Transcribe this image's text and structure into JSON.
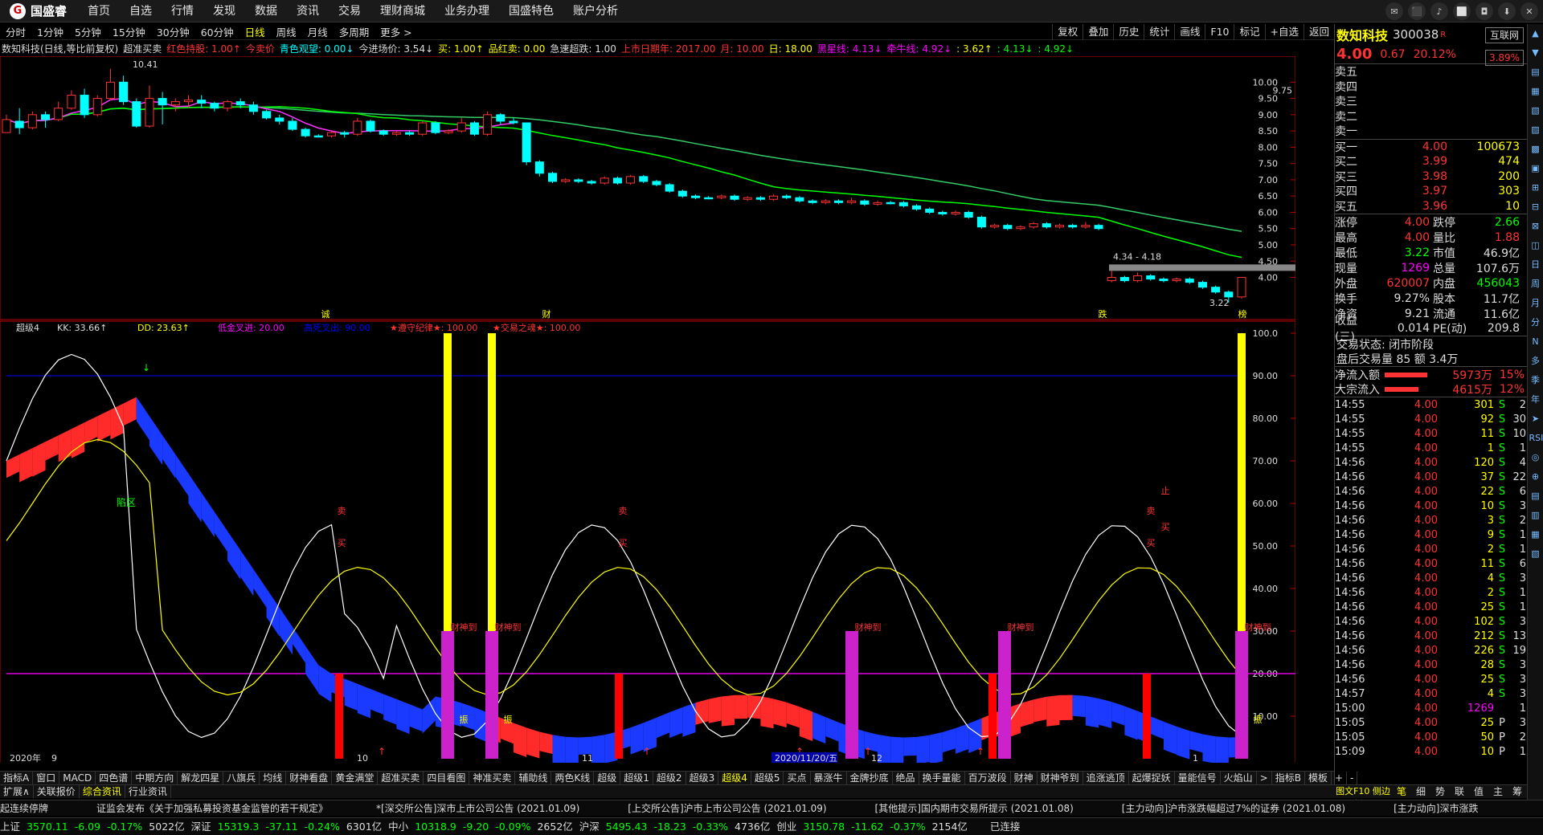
{
  "app": {
    "logo_text": "国盛睿",
    "menu": [
      "首页",
      "自选",
      "行情",
      "发现",
      "数据",
      "资讯",
      "交易",
      "理财商城",
      "业务办理",
      "国盛特色",
      "账户分析"
    ],
    "window_controls": [
      "✉",
      "⬛",
      "♪",
      "⬜",
      "◘",
      "⬇",
      "✕"
    ]
  },
  "periods": {
    "items": [
      "分时",
      "1分钟",
      "5分钟",
      "15分钟",
      "30分钟",
      "60分钟",
      "日线",
      "周线",
      "月线",
      "多周期",
      "更多 >"
    ],
    "active": "日线"
  },
  "right_tools": [
    "复权",
    "叠加",
    "历史",
    "统计",
    "画线",
    "F10",
    "标记",
    "+自选",
    "返回"
  ],
  "chart_info": [
    {
      "text": "数知科技(日线,等比前复权)",
      "color": "white"
    },
    {
      "text": "超准买卖",
      "color": "white"
    },
    {
      "text": "红色持股: 1.00↑",
      "color": "red"
    },
    {
      "text": "今卖价",
      "color": "red"
    },
    {
      "text": "青色观望: 0.00↓",
      "color": "cyan"
    },
    {
      "text": "今进场价: 3.54↓",
      "color": "white"
    },
    {
      "text": "买: 1.00↑",
      "color": "yellow"
    },
    {
      "text": "品红卖: 0.00",
      "color": "yellow"
    },
    {
      "text": "急速超跌: 1.00",
      "color": "white"
    },
    {
      "text": "上市日期年: 2017.00",
      "color": "red"
    },
    {
      "text": "月: 10.00",
      "color": "red"
    },
    {
      "text": "日: 18.00",
      "color": "yellow"
    },
    {
      "text": "黑星线: 4.13↓",
      "color": "magenta"
    },
    {
      "text": "牵牛线: 4.92↓",
      "color": "magenta"
    },
    {
      "text": ": 3.62↑",
      "color": "yellow"
    },
    {
      "text": ": 4.13↓",
      "color": "green"
    },
    {
      "text": ": 4.92↓",
      "color": "green"
    }
  ],
  "chart_data": [
    {
      "type": "candlestick",
      "title": "数知科技(日线,等比前复权)",
      "y_ticks": [
        "10.00",
        "9.50",
        "9.00",
        "8.50",
        "8.00",
        "7.50",
        "7.00",
        "6.50",
        "6.00",
        "5.50",
        "5.00",
        "4.50",
        "4.00"
      ],
      "ylim": [
        3.1,
        10.6
      ],
      "x_ticks": [
        "2020年",
        "9",
        "10",
        "11",
        "2020/11/20/五",
        "12",
        "1"
      ],
      "labels": {
        "high": "10.41",
        "low": "3.22",
        "range": "4.34 - 4.18",
        "price_box": "9.75"
      },
      "markers": [
        "诚",
        "财",
        "跌",
        "榜"
      ],
      "ohlc": [
        [
          8.45,
          8.85,
          8.75,
          9.0,
          1
        ],
        [
          8.8,
          8.6,
          9.2,
          8.4,
          0
        ],
        [
          8.6,
          9.0,
          8.55,
          9.1,
          1
        ],
        [
          9.0,
          8.85,
          9.1,
          8.6,
          0
        ],
        [
          8.85,
          9.2,
          8.8,
          9.4,
          1
        ],
        [
          9.2,
          9.6,
          9.15,
          9.75,
          1
        ],
        [
          9.6,
          9.0,
          9.8,
          8.9,
          0
        ],
        [
          9.0,
          9.5,
          8.95,
          9.6,
          1
        ],
        [
          9.5,
          10.0,
          9.45,
          10.41,
          1
        ],
        [
          10.0,
          9.4,
          10.2,
          9.3,
          0
        ],
        [
          9.4,
          8.65,
          9.5,
          8.6,
          0
        ],
        [
          8.65,
          9.5,
          8.6,
          9.9,
          1
        ],
        [
          9.5,
          9.3,
          9.7,
          8.7,
          0
        ],
        [
          9.3,
          9.4,
          9.1,
          9.5,
          1
        ],
        [
          9.4,
          9.45,
          9.2,
          9.6,
          1
        ],
        [
          9.45,
          9.35,
          9.6,
          9.2,
          0
        ],
        [
          9.35,
          9.2,
          9.4,
          9.1,
          0
        ],
        [
          9.2,
          9.4,
          9.1,
          9.45,
          1
        ],
        [
          9.4,
          9.3,
          9.5,
          9.2,
          0
        ],
        [
          9.3,
          9.1,
          9.4,
          9.0,
          0
        ],
        [
          9.1,
          8.9,
          9.15,
          8.85,
          0
        ],
        [
          8.9,
          8.8,
          9.0,
          8.7,
          0
        ],
        [
          8.8,
          8.55,
          8.9,
          8.5,
          0
        ],
        [
          8.55,
          8.35,
          8.6,
          8.3,
          0
        ],
        [
          8.35,
          8.35,
          8.4,
          8.3,
          0
        ],
        [
          8.35,
          8.45,
          8.3,
          8.5,
          1
        ],
        [
          8.45,
          8.4,
          8.5,
          8.3,
          0
        ],
        [
          8.4,
          8.8,
          8.35,
          8.9,
          1
        ],
        [
          8.8,
          8.5,
          8.85,
          8.45,
          0
        ],
        [
          8.5,
          8.4,
          8.55,
          8.35,
          0
        ],
        [
          8.4,
          8.45,
          8.35,
          8.5,
          1
        ],
        [
          8.45,
          8.4,
          8.5,
          8.35,
          0
        ],
        [
          8.4,
          8.75,
          8.35,
          8.8,
          1
        ],
        [
          8.75,
          8.45,
          8.8,
          8.4,
          0
        ],
        [
          8.45,
          8.5,
          8.4,
          8.55,
          1
        ],
        [
          8.5,
          8.75,
          8.45,
          8.9,
          1
        ],
        [
          8.75,
          8.4,
          8.8,
          8.35,
          0
        ],
        [
          8.4,
          9.0,
          8.35,
          9.1,
          1
        ],
        [
          9.0,
          8.8,
          9.05,
          8.7,
          0
        ],
        [
          8.8,
          8.75,
          8.9,
          8.7,
          0
        ],
        [
          8.75,
          7.55,
          8.75,
          7.45,
          0
        ],
        [
          7.55,
          7.2,
          7.6,
          7.1,
          0
        ],
        [
          7.2,
          6.95,
          7.25,
          6.9,
          0
        ],
        [
          6.95,
          7.0,
          6.9,
          7.05,
          1
        ],
        [
          7.0,
          6.95,
          7.05,
          6.9,
          0
        ],
        [
          6.95,
          6.9,
          7.0,
          6.85,
          0
        ],
        [
          6.9,
          7.05,
          6.85,
          7.1,
          1
        ],
        [
          7.05,
          6.9,
          7.1,
          6.85,
          0
        ],
        [
          6.9,
          7.1,
          6.85,
          7.15,
          1
        ],
        [
          7.1,
          6.95,
          7.15,
          6.9,
          0
        ],
        [
          6.95,
          6.85,
          7.0,
          6.8,
          0
        ],
        [
          6.85,
          6.65,
          6.9,
          6.6,
          0
        ],
        [
          6.65,
          6.5,
          6.7,
          6.45,
          0
        ],
        [
          6.5,
          6.45,
          6.55,
          6.4,
          0
        ],
        [
          6.45,
          6.45,
          6.5,
          6.4,
          0
        ],
        [
          6.45,
          6.5,
          6.4,
          6.55,
          1
        ],
        [
          6.5,
          6.4,
          6.55,
          6.35,
          0
        ],
        [
          6.4,
          6.45,
          6.35,
          6.5,
          1
        ],
        [
          6.45,
          6.4,
          6.5,
          6.35,
          0
        ],
        [
          6.4,
          6.5,
          6.35,
          6.55,
          1
        ],
        [
          6.5,
          6.45,
          6.55,
          6.4,
          0
        ],
        [
          6.45,
          6.35,
          6.5,
          6.3,
          0
        ],
        [
          6.35,
          6.3,
          6.4,
          6.25,
          0
        ],
        [
          6.3,
          6.35,
          6.25,
          6.4,
          1
        ],
        [
          6.35,
          6.3,
          6.4,
          6.25,
          0
        ],
        [
          6.3,
          6.35,
          6.25,
          6.45,
          1
        ],
        [
          6.35,
          6.25,
          6.4,
          6.2,
          0
        ],
        [
          6.25,
          6.3,
          6.2,
          6.35,
          1
        ],
        [
          6.3,
          6.3,
          6.35,
          6.25,
          0
        ],
        [
          6.3,
          6.2,
          6.35,
          6.15,
          0
        ],
        [
          6.2,
          6.1,
          6.25,
          6.05,
          0
        ],
        [
          6.1,
          6.0,
          6.15,
          5.95,
          0
        ],
        [
          6.0,
          5.95,
          6.05,
          5.9,
          0
        ],
        [
          5.95,
          6.0,
          5.9,
          6.05,
          1
        ],
        [
          6.0,
          5.85,
          6.05,
          5.8,
          0
        ],
        [
          5.85,
          5.55,
          5.9,
          5.5,
          0
        ],
        [
          5.55,
          5.6,
          5.5,
          5.65,
          1
        ],
        [
          5.6,
          5.5,
          5.65,
          5.45,
          0
        ],
        [
          5.5,
          5.55,
          5.45,
          5.6,
          1
        ],
        [
          5.55,
          5.65,
          5.5,
          5.7,
          1
        ],
        [
          5.65,
          5.55,
          5.7,
          5.5,
          0
        ],
        [
          5.55,
          5.6,
          5.5,
          5.65,
          1
        ],
        [
          5.6,
          5.55,
          5.65,
          5.5,
          0
        ],
        [
          5.55,
          5.6,
          5.5,
          5.7,
          1
        ],
        [
          5.6,
          5.5,
          5.65,
          5.45,
          0
        ],
        [
          3.9,
          4.0,
          3.85,
          4.2,
          1
        ],
        [
          4.0,
          3.9,
          4.05,
          3.85,
          0
        ],
        [
          3.9,
          4.05,
          3.85,
          4.15,
          1
        ],
        [
          4.05,
          3.95,
          4.1,
          3.9,
          0
        ],
        [
          3.95,
          3.9,
          4.0,
          3.85,
          0
        ],
        [
          3.9,
          3.95,
          3.85,
          4.0,
          1
        ],
        [
          3.95,
          3.85,
          4.0,
          3.8,
          0
        ],
        [
          3.85,
          3.7,
          3.9,
          3.65,
          0
        ],
        [
          3.7,
          3.55,
          3.75,
          3.5,
          0
        ],
        [
          3.55,
          3.4,
          3.6,
          3.22,
          0
        ],
        [
          3.4,
          4.0,
          3.35,
          4.0,
          1
        ]
      ]
    },
    {
      "type": "line",
      "title": "超级4",
      "legend": [
        "KK: 33.66↑",
        "DD: 23.63↑",
        "低金叉进: 20.00",
        "高死叉出: 90.00",
        "★遵守纪律★: 100.00",
        "★交易之魂★: 100.00"
      ],
      "y_ticks": [
        "100.0",
        "90.00",
        "80.00",
        "70.00",
        "60.00",
        "50.00",
        "40.00",
        "30.00",
        "20.00",
        "10.00"
      ],
      "ylim": [
        0,
        100
      ],
      "lines": {
        "low": 20,
        "high": 90
      },
      "annotations": [
        "陷区",
        "卖",
        "买",
        "财神到",
        "振",
        "止"
      ]
    }
  ],
  "right_panel": {
    "name": "数知科技",
    "code": "300038",
    "code_flag": "R",
    "btn_top": "互联网",
    "price": "4.00",
    "change": "0.67",
    "change_pct": "20.12%",
    "price_box": "3.89%",
    "sells": [
      {
        "label": "卖五",
        "price": "",
        "vol": ""
      },
      {
        "label": "卖四",
        "price": "",
        "vol": ""
      },
      {
        "label": "卖三",
        "price": "",
        "vol": ""
      },
      {
        "label": "卖二",
        "price": "",
        "vol": ""
      },
      {
        "label": "卖一",
        "price": "",
        "vol": ""
      }
    ],
    "buys": [
      {
        "label": "买一",
        "price": "4.00",
        "vol": "100673"
      },
      {
        "label": "买二",
        "price": "3.99",
        "vol": "474"
      },
      {
        "label": "买三",
        "price": "3.98",
        "vol": "200"
      },
      {
        "label": "买四",
        "price": "3.97",
        "vol": "303"
      },
      {
        "label": "买五",
        "price": "3.96",
        "vol": "10"
      }
    ],
    "stats": [
      {
        "k1": "涨停",
        "v1": "4.00",
        "c1": "red",
        "k2": "跌停",
        "v2": "2.66",
        "c2": "green"
      },
      {
        "k1": "最高",
        "v1": "4.00",
        "c1": "red",
        "k2": "量比",
        "v2": "1.88",
        "c2": "red"
      },
      {
        "k1": "最低",
        "v1": "3.22",
        "c1": "green",
        "k2": "市值",
        "v2": "46.9亿",
        "c2": "white"
      },
      {
        "k1": "现量",
        "v1": "1269",
        "c1": "magenta",
        "k2": "总量",
        "v2": "107.6万",
        "c2": "white"
      },
      {
        "k1": "外盘",
        "v1": "620007",
        "c1": "red",
        "k2": "内盘",
        "v2": "456043",
        "c2": "green"
      },
      {
        "k1": "换手",
        "v1": "9.27%",
        "c1": "white",
        "k2": "股本",
        "v2": "11.7亿",
        "c2": "white"
      },
      {
        "k1": "净资",
        "v1": "9.21",
        "c1": "white",
        "k2": "流通",
        "v2": "11.6亿",
        "c2": "white"
      },
      {
        "k1": "收益(三)",
        "v1": "0.014",
        "c1": "white",
        "k2": "PE(动)",
        "v2": "209.8",
        "c2": "white"
      }
    ],
    "trade_state": "交易状态: 闭市阶段",
    "after_hours": "盘后交易量 85 额 3.4万",
    "flows": [
      {
        "label": "净流入额",
        "value": "5973万",
        "pct": "15%",
        "fill": 0.75
      },
      {
        "label": "大宗流入",
        "value": "4615万",
        "pct": "12%",
        "fill": 0.6
      }
    ],
    "ticks": [
      {
        "t": "14:55",
        "p": "4.00",
        "v": "301",
        "s": "S",
        "n": "2"
      },
      {
        "t": "14:55",
        "p": "4.00",
        "v": "92",
        "s": "S",
        "n": "30"
      },
      {
        "t": "14:55",
        "p": "4.00",
        "v": "11",
        "s": "S",
        "n": "10"
      },
      {
        "t": "14:55",
        "p": "4.00",
        "v": "1",
        "s": "S",
        "n": "1"
      },
      {
        "t": "14:56",
        "p": "4.00",
        "v": "120",
        "s": "S",
        "n": "4"
      },
      {
        "t": "14:56",
        "p": "4.00",
        "v": "37",
        "s": "S",
        "n": "22"
      },
      {
        "t": "14:56",
        "p": "4.00",
        "v": "22",
        "s": "S",
        "n": "6"
      },
      {
        "t": "14:56",
        "p": "4.00",
        "v": "10",
        "s": "S",
        "n": "3"
      },
      {
        "t": "14:56",
        "p": "4.00",
        "v": "3",
        "s": "S",
        "n": "2"
      },
      {
        "t": "14:56",
        "p": "4.00",
        "v": "9",
        "s": "S",
        "n": "1"
      },
      {
        "t": "14:56",
        "p": "4.00",
        "v": "2",
        "s": "S",
        "n": "1"
      },
      {
        "t": "14:56",
        "p": "4.00",
        "v": "11",
        "s": "S",
        "n": "6"
      },
      {
        "t": "14:56",
        "p": "4.00",
        "v": "4",
        "s": "S",
        "n": "3"
      },
      {
        "t": "14:56",
        "p": "4.00",
        "v": "2",
        "s": "S",
        "n": "1"
      },
      {
        "t": "14:56",
        "p": "4.00",
        "v": "25",
        "s": "S",
        "n": "1"
      },
      {
        "t": "14:56",
        "p": "4.00",
        "v": "102",
        "s": "S",
        "n": "3"
      },
      {
        "t": "14:56",
        "p": "4.00",
        "v": "212",
        "s": "S",
        "n": "13"
      },
      {
        "t": "14:56",
        "p": "4.00",
        "v": "226",
        "s": "S",
        "n": "19"
      },
      {
        "t": "14:56",
        "p": "4.00",
        "v": "28",
        "s": "S",
        "n": "3"
      },
      {
        "t": "14:56",
        "p": "4.00",
        "v": "25",
        "s": "S",
        "n": "3"
      },
      {
        "t": "14:57",
        "p": "4.00",
        "v": "4",
        "s": "S",
        "n": "3"
      },
      {
        "t": "15:00",
        "p": "4.00",
        "v": "1269",
        "s": "",
        "n": "1"
      },
      {
        "t": "15:05",
        "p": "4.00",
        "v": "25",
        "s": "P",
        "n": "3"
      },
      {
        "t": "15:05",
        "p": "4.00",
        "v": "50",
        "s": "P",
        "n": "2"
      },
      {
        "t": "15:09",
        "p": "4.00",
        "v": "10",
        "s": "P",
        "n": "1"
      }
    ]
  },
  "sidebar_icons": [
    "▲",
    "▼",
    "▤",
    "▦",
    "▧",
    "▨",
    "▩",
    "▣",
    "⊞",
    "⊟",
    "⊠",
    "◫",
    "日",
    "周",
    "月",
    "分",
    "N",
    "多",
    "季",
    "年",
    "➤",
    "RSI",
    "◎",
    "⊕",
    "▤",
    "▥",
    "▦",
    "▧"
  ],
  "tab_row": [
    "指标A",
    "窗口",
    "MACD",
    "四色谱",
    "中期方向",
    "解龙四星",
    "八旗兵",
    "均线",
    "财神看盘",
    "黄金满堂",
    "超准买卖",
    "四目看图",
    "神准买卖",
    "辅助线",
    "两色K线",
    "超级",
    "超级1",
    "超级2",
    "超级3",
    "超级4",
    "超级5",
    "买点",
    "暴涨牛",
    "金牌抄底",
    "绝品",
    "换手量能",
    "百万波段",
    "财神",
    "财神爷到",
    "追涨逃顶",
    "起爆捉妖",
    "量能信号",
    "火焰山",
    ">",
    "指标B",
    "模板",
    "+",
    "-"
  ],
  "tab_row_active": "超级4",
  "tab_row2": [
    "扩展∧",
    "关联报价",
    "综合资讯",
    "行业资讯"
  ],
  "tab_row2_active": "综合资讯",
  "right_tabs_note": "图文F10 侧边栏《",
  "right_tabs": [
    "笔",
    "细",
    "势",
    "联",
    "值",
    "主",
    "筹"
  ],
  "news": [
    "起连续停牌",
    "证监会发布《关于加强私募投资基金监管的若干规定》",
    "*[深交所公告]深市上市公司公告 (2021.01.09)",
    "[上交所公告]沪市上市公司公告 (2021.01.09)",
    "[其他提示]国内期市交易所提示 (2021.01.08)",
    "[主力动向]沪市涨跌幅超过7%的证券 (2021.01.08)",
    "[主力动向]深市涨跌"
  ],
  "status": [
    {
      "name": "上证",
      "v": "3570.11",
      "c": "-6.09",
      "p": "-0.17%",
      "a": "5022亿"
    },
    {
      "name": "深证",
      "v": "15319.3",
      "c": "-37.11",
      "p": "-0.24%",
      "a": "6301亿"
    },
    {
      "name": "中小",
      "v": "10318.9",
      "c": "-9.20",
      "p": "-0.09%",
      "a": "2652亿"
    },
    {
      "name": "沪深",
      "v": "5495.43",
      "c": "-18.23",
      "p": "-0.33%",
      "a": "4736亿"
    },
    {
      "name": "创业",
      "v": "3150.78",
      "c": "-11.62",
      "p": "-0.37%",
      "a": "2154亿"
    }
  ],
  "connection": "已连接",
  "colors": {
    "up": "#ff3333",
    "down": "#00ffff",
    "ma1": "#ff33ff",
    "ma2": "#00ff00",
    "ma3": "#33cc66",
    "red_fill": "#ff2a2a",
    "blue_fill": "#1a3aff",
    "yellow": "#ffff00",
    "magenta": "#cc22cc"
  }
}
